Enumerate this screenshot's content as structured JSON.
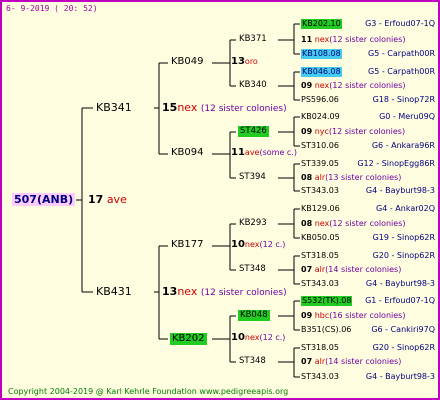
{
  "header": {
    "date": "6-  9-2019 (  20:  52)"
  },
  "footer": {
    "copyright": "Copyright 2004-2019 @ Karl Kehrle Foundation     www.pedigreeapis.org"
  },
  "colors": {
    "frame": "#c000c0",
    "background": "#fffde0",
    "highlight_green": "#22cc22",
    "highlight_cyan": "#44ccee",
    "root_bg": "#ffccff",
    "red": "#cc0000",
    "navy": "#000080",
    "purple": "#7000a0"
  },
  "pedigree": {
    "root": {
      "label": "507(ANB)"
    },
    "root_year": {
      "year": "17",
      "text": "ave"
    },
    "p1": {
      "label": "KB341"
    },
    "p1_year": {
      "year": "15",
      "text": "nex",
      "note": "(12 sister colonies)"
    },
    "p2": {
      "label": "KB431"
    },
    "p2_year": {
      "year": "13",
      "text": "nex",
      "note": "(12 sister colonies)"
    },
    "g1": {
      "label": "KB049"
    },
    "g1_year": {
      "year": "13",
      "text": "oro"
    },
    "g2": {
      "label": "KB094"
    },
    "g2_year": {
      "year": "11",
      "text": "ave",
      "note": "(some c.)"
    },
    "g3": {
      "label": "KB177"
    },
    "g3_year": {
      "year": "10",
      "text": "nex",
      "note": "(12 c.)"
    },
    "g4": {
      "label": "KB202"
    },
    "g4_year": {
      "year": "10",
      "text": "nex",
      "note": "(12 c.)"
    },
    "gg": [
      {
        "label": "KB371"
      },
      {
        "label": "KB340"
      },
      {
        "label": "ST426"
      },
      {
        "label": "ST394"
      },
      {
        "label": "KB293"
      },
      {
        "label": "ST348"
      },
      {
        "label": "KB048"
      },
      {
        "label": "ST348"
      }
    ],
    "gg_years": [
      {
        "year": "11",
        "text": "nex",
        "note": "(12 sister colonies)"
      },
      {
        "year": "09",
        "text": "nex",
        "note": "(12 sister colonies)"
      },
      {
        "year": "09",
        "text": "nyc",
        "note": "(12 sister colonies)"
      },
      {
        "year": "08",
        "text": "alr",
        "note": "(13 sister colonies)"
      },
      {
        "year": "08",
        "text": "nex",
        "note": "(12 sister colonies)"
      },
      {
        "year": "07",
        "text": "alr",
        "note": "(14 sister colonies)"
      },
      {
        "year": "09",
        "text": "hbc",
        "note": "(16 sister colonies)"
      },
      {
        "year": "07",
        "text": "alr",
        "note": "(14 sister colonies)"
      }
    ],
    "g4nodes": [
      {
        "id": "KB202.10",
        "loc": "G3 - Erfoud07-1Q"
      },
      {
        "id": "KB108.08",
        "loc": "G5 - Carpath00R"
      },
      {
        "id": "KB046.08",
        "loc": "G5 - Carpath00R"
      },
      {
        "id": "PS596.06",
        "loc": "G18 - Sinop72R"
      },
      {
        "id": "KB024.09",
        "loc": "G0 - Meru09Q"
      },
      {
        "id": "ST310.06",
        "loc": "G6 - Ankara96R"
      },
      {
        "id": "ST339.05",
        "loc": "G12 - SinopEgg86R"
      },
      {
        "id": "ST343.03",
        "loc": "G4 - Bayburt98-3"
      },
      {
        "id": "KB129.06",
        "loc": "G4 - Ankar02Q"
      },
      {
        "id": "KB050.05",
        "loc": "G19 - Sinop62R"
      },
      {
        "id": "ST318.05",
        "loc": "G20 - Sinop62R"
      },
      {
        "id": "ST343.03",
        "loc": "G4 - Bayburt98-3"
      },
      {
        "id": "S532(TK).08",
        "loc": "G1 - Erfoud07-1Q"
      },
      {
        "id": "B351(CS).06",
        "loc": "G6 - Cankiri97Q"
      },
      {
        "id": "ST318.05",
        "loc": "G20 - Sinop62R"
      },
      {
        "id": "ST343.03",
        "loc": "G4 - Bayburt98-3"
      }
    ]
  }
}
